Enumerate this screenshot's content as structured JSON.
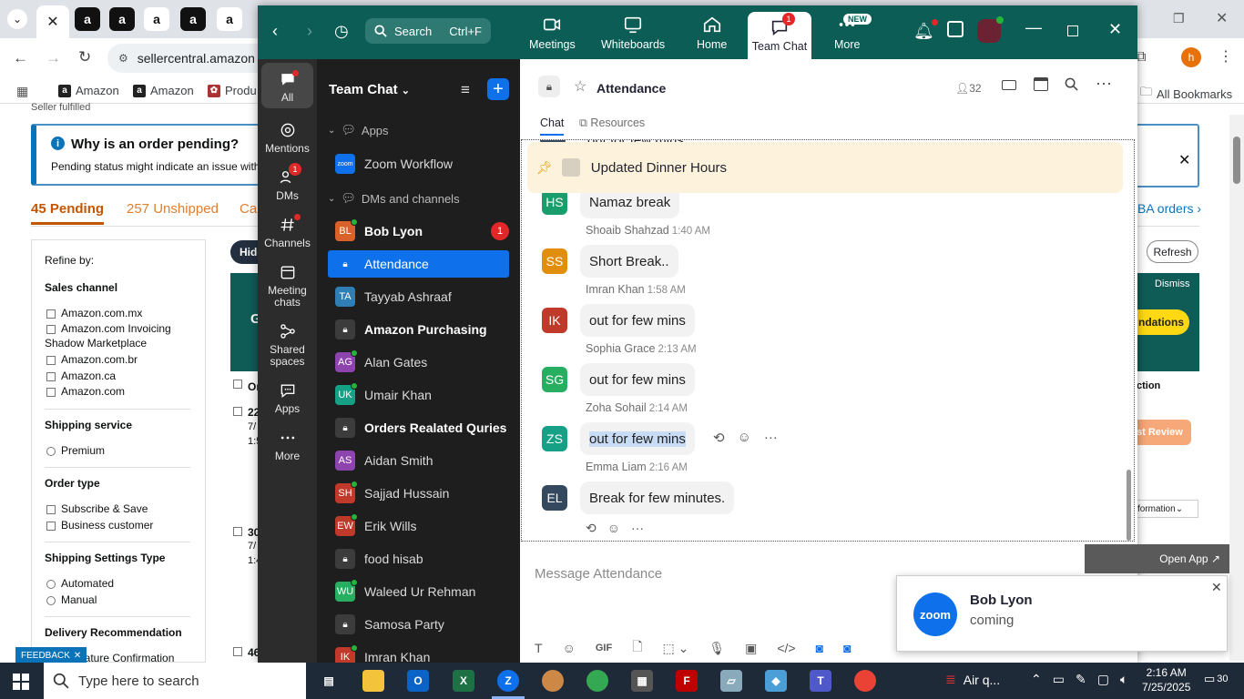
{
  "browser": {
    "address": "sellercentral.amazon",
    "bookmarks": [
      "Amazon",
      "Amazon",
      "Produ"
    ],
    "all_bookmarks": "All Bookmarks",
    "profile_initial": "h"
  },
  "seller": {
    "fulfilled_text": "Seller fulfilled",
    "banner_title": "Why is an order pending?",
    "banner_text": "Pending status might indicate an issue with t",
    "tabs": [
      "45 Pending",
      "257 Unshipped",
      "Can"
    ],
    "fba_link": "BA orders",
    "refine_by": "Refine by:",
    "sales_channel_title": "Sales channel",
    "sales_channels": [
      "Amazon.com.mx",
      "Amazon.com Invoicing",
      "Shadow Marketplace",
      "Amazon.com.br",
      "Amazon.ca",
      "Amazon.com"
    ],
    "shipping_service_title": "Shipping service",
    "shipping_service": "Premium",
    "order_type_title": "Order type",
    "order_types": [
      "Subscribe & Save",
      "Business customer"
    ],
    "shipping_settings_title": "Shipping Settings Type",
    "shipping_settings": [
      "Automated",
      "Manual"
    ],
    "delivery_title": "Delivery Recommendation",
    "delivery_item": "nature Confirmation",
    "feedback": "FEEDBACK",
    "hide": "Hide",
    "refresh": "Refresh",
    "dismiss": "Dismiss",
    "recommendations": "ndations",
    "action": "ction",
    "review": "st Review",
    "information": "formation",
    "row_a": "Or",
    "row_b": "22",
    "row_c": "7/",
    "row_d": "1:5",
    "row_e": "30",
    "row_f": "7/",
    "row_g": "1:4",
    "row_h": "46"
  },
  "zoom": {
    "search_label": "Search",
    "search_shortcut": "Ctrl+F",
    "nav": [
      "Meetings",
      "Whiteboards",
      "Home",
      "Team Chat",
      "More"
    ],
    "team_chat_badge": "1",
    "new_badge": "NEW",
    "rail": [
      "All",
      "Mentions",
      "DMs",
      "Channels",
      "Meeting chats",
      "Shared spaces",
      "Apps",
      "More"
    ],
    "rail_dms_badge": "1",
    "sidebar_title": "Team Chat",
    "section_apps": "Apps",
    "zoom_workflow": "Zoom Workflow",
    "section_dms": "DMs and channels",
    "channels": [
      {
        "initials": "BL",
        "name": "Bob Lyon",
        "color": "#d9622b",
        "bold": true,
        "badge": "1",
        "online": true
      },
      {
        "initials": "",
        "name": "Attendance",
        "color": "#0e71eb",
        "bold": false,
        "lock": true,
        "selected": true
      },
      {
        "initials": "TA",
        "name": "Tayyab Ashraaf",
        "color": "#2f7fb5",
        "bold": false
      },
      {
        "initials": "",
        "name": "Amazon Purchasing",
        "bold": true,
        "lock": true
      },
      {
        "initials": "AG",
        "name": "Alan Gates",
        "color": "#8e44ad",
        "bold": false,
        "online": true
      },
      {
        "initials": "UK",
        "name": "Umair Khan",
        "color": "#16a085",
        "bold": false,
        "online": true
      },
      {
        "initials": "",
        "name": "Orders Realated Quries",
        "bold": true,
        "lock": true
      },
      {
        "initials": "AS",
        "name": "Aidan Smith",
        "color": "#8e44ad",
        "bold": false
      },
      {
        "initials": "SH",
        "name": "Sajjad Hussain",
        "color": "#c0392b",
        "bold": false,
        "online": true
      },
      {
        "initials": "EW",
        "name": "Erik Wills",
        "color": "#c0392b",
        "bold": false,
        "online": true
      },
      {
        "initials": "",
        "name": "food hisab",
        "bold": false,
        "lock": true
      },
      {
        "initials": "WU",
        "name": "Waleed Ur Rehman",
        "color": "#27ae60",
        "bold": false,
        "online": true
      },
      {
        "initials": "",
        "name": "Samosa Party",
        "bold": false,
        "lock": true
      },
      {
        "initials": "IK",
        "name": "Imran Khan",
        "color": "#c0392b",
        "bold": false,
        "online": true
      }
    ],
    "chat_title": "Attendance",
    "member_count": "32",
    "tab_chat": "Chat",
    "tab_resources": "Resources",
    "cut_msg": "out for few mins",
    "pinned": "Updated Dinner Hours",
    "messages": [
      {
        "initials": "HS",
        "name": "",
        "time": "",
        "text": "Namaz break",
        "color": "#1a9d6c"
      },
      {
        "initials": "SS",
        "name": "Shoaib Shahzad",
        "time": "1:40 AM",
        "text": "Short Break..",
        "color": "#e08e0b"
      },
      {
        "initials": "IK",
        "name": "Imran Khan",
        "time": "1:58 AM",
        "text": "out for few mins",
        "color": "#c0392b"
      },
      {
        "initials": "SG",
        "name": "Sophia Grace",
        "time": "2:13 AM",
        "text": "out for few mins",
        "color": "#27ae60"
      },
      {
        "initials": "ZS",
        "name": "Zoha Sohail",
        "time": "2:14 AM",
        "text": "out for few mins",
        "color": "#16a085"
      },
      {
        "initials": "EL",
        "name": "Emma Liam",
        "time": "2:16 AM",
        "text": "Break for few minutes.",
        "color": "#34495e"
      }
    ],
    "composer_placeholder": "Message Attendance",
    "gif_label": "GIF",
    "notification": {
      "logo": "zoom",
      "name": "Bob Lyon",
      "text": "coming"
    },
    "open_app": "Open App"
  },
  "taskbar": {
    "search_placeholder": "Type here to search",
    "weather": "Air q...",
    "time": "2:16 AM",
    "date": "7/25/2025",
    "notif_count": "30"
  }
}
